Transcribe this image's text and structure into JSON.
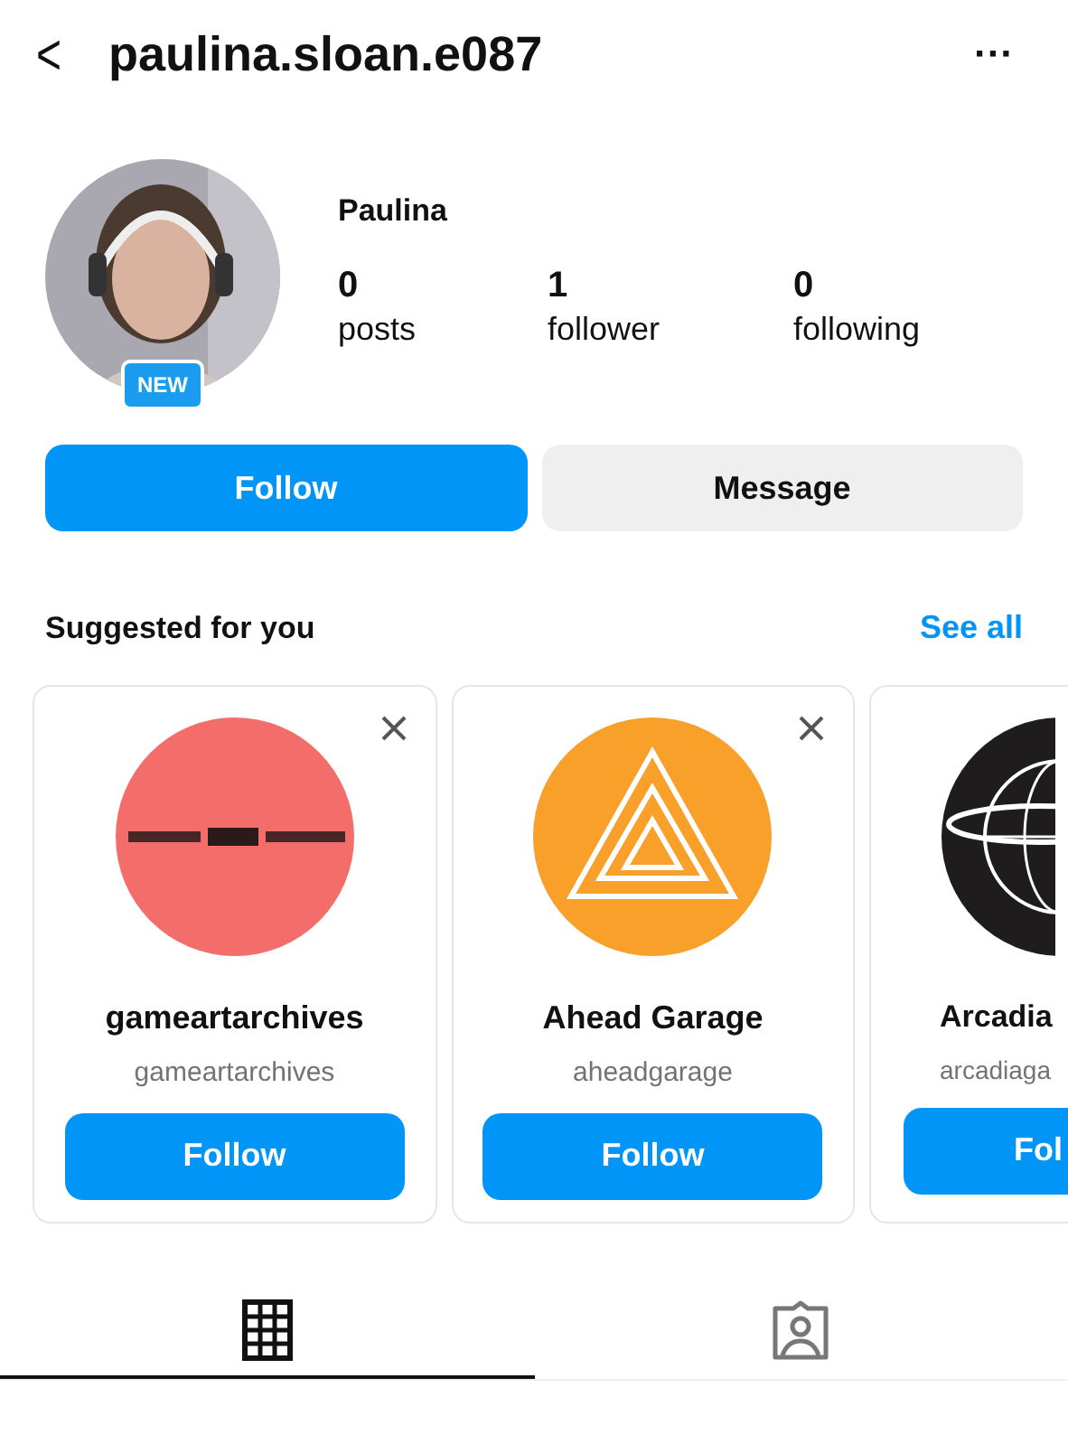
{
  "header": {
    "back": "<",
    "username": "paulina.sloan.e087",
    "more": "···"
  },
  "profile": {
    "badge": "NEW",
    "name": "Paulina",
    "stats": [
      {
        "value": "0",
        "label": "posts"
      },
      {
        "value": "1",
        "label": "follower"
      },
      {
        "value": "0",
        "label": "following"
      }
    ]
  },
  "actions": [
    {
      "label": "Follow",
      "kind": "primary"
    },
    {
      "label": "Message",
      "kind": "secondary"
    }
  ],
  "suggested": {
    "title": "Suggested for you",
    "see_all": "See all",
    "cards": [
      {
        "name": "gameartarchives",
        "handle": "gameartarchives",
        "button": "Follow",
        "dismissable": true
      },
      {
        "name": "Ahead Garage",
        "handle": "aheadgarage",
        "button": "Follow",
        "dismissable": true
      },
      {
        "name": "Arcadia",
        "handle": "arcadiaga",
        "button": "Fol",
        "dismissable": false
      }
    ]
  },
  "tabs": [
    {
      "kind": "grid",
      "selected": true
    },
    {
      "kind": "tagged",
      "selected": false
    }
  ]
}
